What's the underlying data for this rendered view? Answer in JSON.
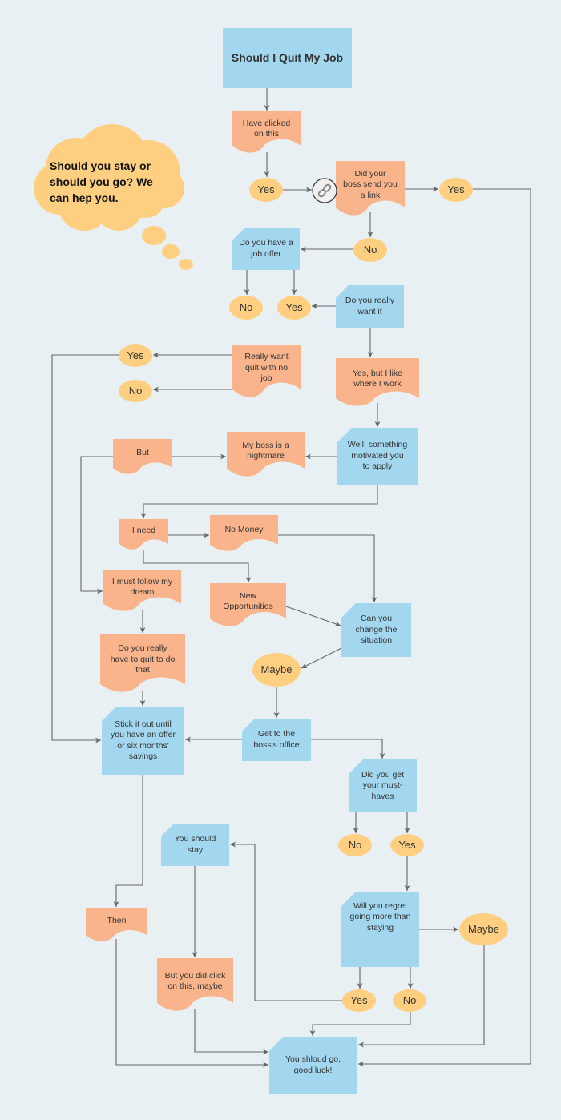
{
  "title": "Should I Quit My Job",
  "thought_bubble": "Should you stay or\nshould you go? We\ncan hep you.",
  "colors": {
    "background": "#e9f0f4",
    "blue_node": "#a2d7ef",
    "orange_node": "#f9b48b",
    "yellow_oval": "#fecf80",
    "connector": "#666666",
    "text": "#333333"
  },
  "nodes": {
    "n_title": "Should I Quit My Job",
    "n_clicked": "Have clicked\non this",
    "n_yes1": "Yes",
    "n_link_q": "Did your\nboss send you\na link",
    "n_yes_right": "Yes",
    "n_no1": "No",
    "n_job_offer": "Do you have a\njob offer",
    "n_no2": "No",
    "n_yes2": "Yes",
    "n_really_want": "Do you really\nwant it",
    "n_quit_nojob": "Really want\nquit with no\njob",
    "n_yes3": "Yes",
    "n_no3": "No",
    "n_like_work": "Yes, but I like\nwhere I work",
    "n_but": "But",
    "n_boss_nightmare": "My boss is a\nnightmare",
    "n_motivated": "Well, something\nmotivated you\nto apply",
    "n_ineed": "I need",
    "n_nomoney": "No Money",
    "n_dream": "I must follow my\ndream",
    "n_newopp": "New\nOpportunities",
    "n_change": "Can you\nchange the\nsituation",
    "n_quit_that": "Do you really\nhave to quit to do\nthat",
    "n_maybe1": "Maybe",
    "n_stick": "Stick it out until\nyou have an offer\nor six months'\nsavings",
    "n_office": "Get to the\nboss's office",
    "n_musthaves": "Did you get\nyour must-\nhaves",
    "n_stay": "You should\nstay",
    "n_no4": "No",
    "n_yes4": "Yes",
    "n_then": "Then",
    "n_regret": "Will you regret\ngoing more than\nstaying",
    "n_maybe2": "Maybe",
    "n_didclick": "But you did click\non this, maybe",
    "n_yes5": "Yes",
    "n_no5": "No",
    "n_go": "You shloud go,\ngood luck!"
  },
  "icons": {
    "link_icon": "link-icon"
  }
}
